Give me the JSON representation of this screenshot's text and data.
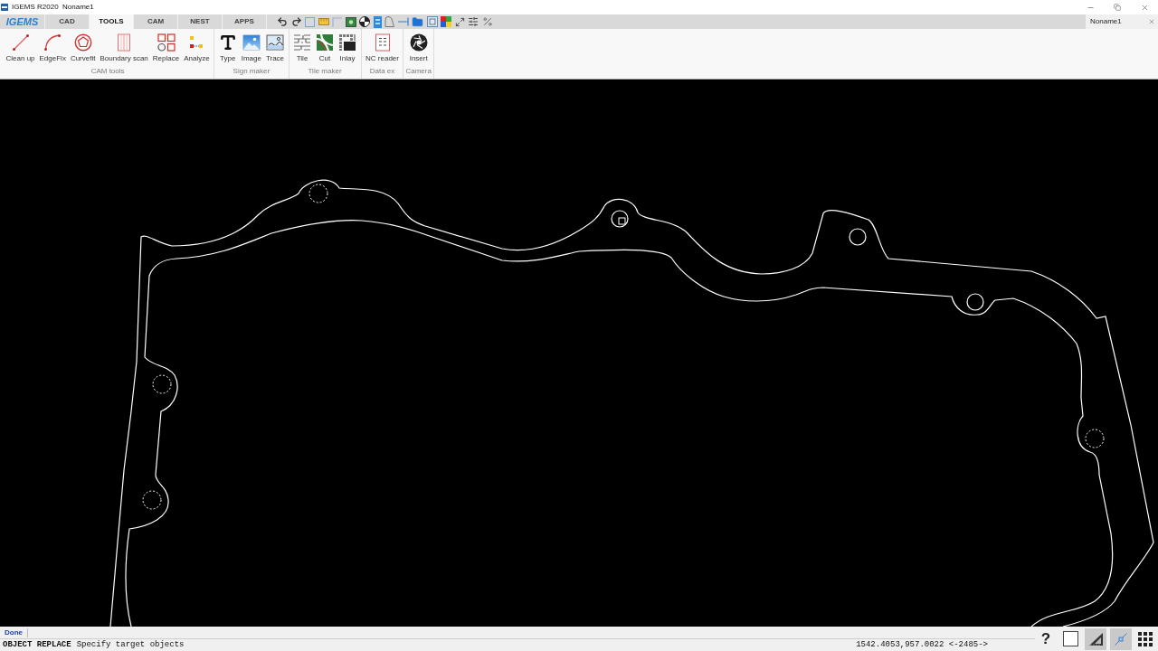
{
  "window": {
    "title": "IGEMS R2020  Noname1"
  },
  "tab_bar": {
    "logo": "IGEMS",
    "tabs": [
      {
        "label": "CAD",
        "selected": false
      },
      {
        "label": "TOOLS",
        "selected": true
      },
      {
        "label": "CAM",
        "selected": false
      },
      {
        "label": "NEST",
        "selected": false
      },
      {
        "label": "APPS",
        "selected": false
      }
    ],
    "document_tab": "Noname1"
  },
  "ribbon": {
    "groups": [
      {
        "label": "CAM tools",
        "tools": [
          "Clean up",
          "EdgeFix",
          "Curvefit",
          "Boundary scan",
          "Replace",
          "Analyze"
        ]
      },
      {
        "label": "Sign maker",
        "tools": [
          "Type",
          "Image",
          "Trace"
        ]
      },
      {
        "label": "Tile maker",
        "tools": [
          "Tile",
          "Cut",
          "Inlay"
        ]
      },
      {
        "label": "Data ex",
        "tools": [
          "NC reader"
        ]
      },
      {
        "label": "Camera",
        "tools": [
          "Insert"
        ]
      }
    ]
  },
  "status_bar": {
    "message": "Done",
    "command": "OBJECT REPLACE",
    "prompt": "Specify target objects",
    "coordinates": "1542.4053,957.0022 <-2485->",
    "toggles": [
      {
        "kind": "help",
        "label": "?",
        "on": false
      },
      {
        "kind": "square",
        "on": false
      },
      {
        "kind": "set_square",
        "on": true
      },
      {
        "kind": "snap",
        "on": true
      },
      {
        "kind": "grid",
        "on": false
      }
    ]
  }
}
